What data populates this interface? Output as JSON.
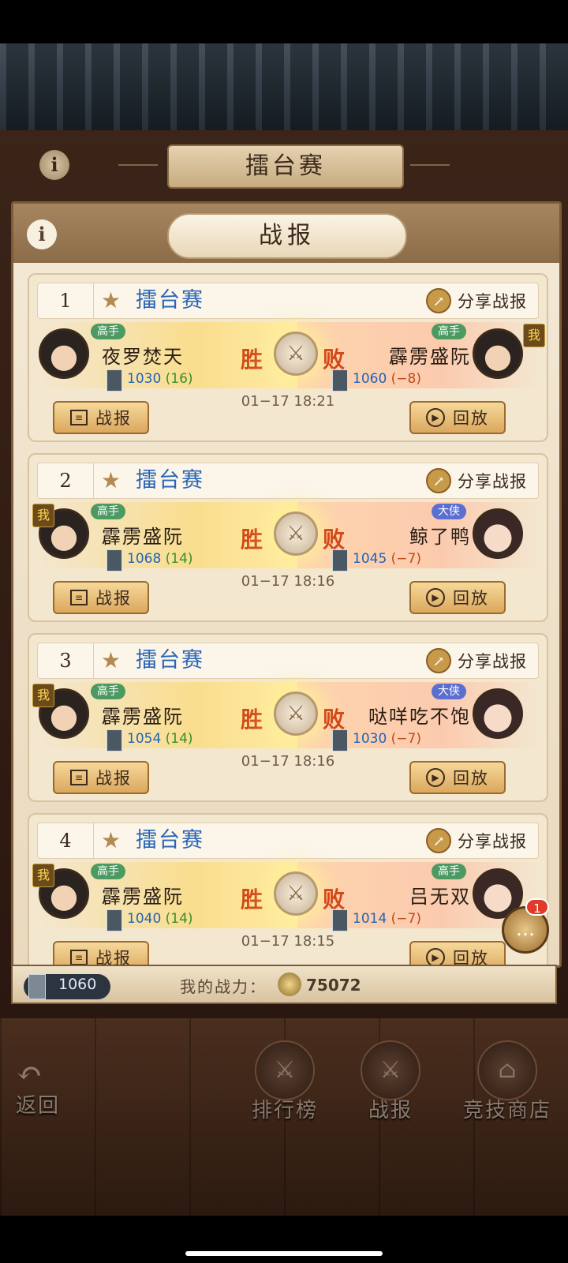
{
  "screen_title": "擂台赛",
  "panel_title": "战报",
  "info_glyph": "i",
  "records": [
    {
      "index": "1",
      "type": "擂台赛",
      "share": "分享战报",
      "left": {
        "rank": "高手",
        "rank_style": "gaoshou",
        "name": "夜罗焚天",
        "score": "1030",
        "delta": "(16)",
        "me": false,
        "avatar": "male"
      },
      "right": {
        "rank": "高手",
        "rank_style": "gaoshou",
        "name": "霹雳盛阮",
        "score": "1060",
        "delta": "(−8)",
        "me": true,
        "avatar": "male"
      },
      "result_left": "胜",
      "result_right": "败",
      "time": "01−17 18:21",
      "report_btn": "战报",
      "replay_btn": "回放"
    },
    {
      "index": "2",
      "type": "擂台赛",
      "share": "分享战报",
      "left": {
        "rank": "高手",
        "rank_style": "gaoshou",
        "name": "霹雳盛阮",
        "score": "1068",
        "delta": "(14)",
        "me": true,
        "avatar": "male"
      },
      "right": {
        "rank": "大侠",
        "rank_style": "daxia",
        "name": "鲸了鸭",
        "score": "1045",
        "delta": "(−7)",
        "me": false,
        "avatar": "female"
      },
      "result_left": "胜",
      "result_right": "败",
      "time": "01−17 18:16",
      "report_btn": "战报",
      "replay_btn": "回放"
    },
    {
      "index": "3",
      "type": "擂台赛",
      "share": "分享战报",
      "left": {
        "rank": "高手",
        "rank_style": "gaoshou",
        "name": "霹雳盛阮",
        "score": "1054",
        "delta": "(14)",
        "me": true,
        "avatar": "male"
      },
      "right": {
        "rank": "大侠",
        "rank_style": "daxia",
        "name": "哒咩吃不饱",
        "score": "1030",
        "delta": "(−7)",
        "me": false,
        "avatar": "female"
      },
      "result_left": "胜",
      "result_right": "败",
      "time": "01−17 18:16",
      "report_btn": "战报",
      "replay_btn": "回放"
    },
    {
      "index": "4",
      "type": "擂台赛",
      "share": "分享战报",
      "left": {
        "rank": "高手",
        "rank_style": "gaoshou",
        "name": "霹雳盛阮",
        "score": "1040",
        "delta": "(14)",
        "me": true,
        "avatar": "male"
      },
      "right": {
        "rank": "高手",
        "rank_style": "gaoshou",
        "name": "吕无双",
        "score": "1014",
        "delta": "(−7)",
        "me": false,
        "avatar": "female"
      },
      "result_left": "胜",
      "result_right": "败",
      "time": "01−17 18:15",
      "report_btn": "战报",
      "replay_btn": "回放"
    }
  ],
  "me_badge": "我",
  "chat_badge": "1",
  "my_score": "1060",
  "power_label": "我的战力：",
  "power_value": "75072",
  "nav": {
    "back": "返回",
    "items": [
      {
        "label": "排行榜",
        "icon": "ranking-icon"
      },
      {
        "label": "战报",
        "icon": "battle-report-icon"
      },
      {
        "label": "竞技商店",
        "icon": "shop-icon"
      }
    ]
  },
  "colors": {
    "win_lose": "#d24818",
    "score": "#1f63b8",
    "delta_positive": "#3a8e2a",
    "delta_negative": "#c04a18",
    "match_type": "#2a66b6"
  }
}
